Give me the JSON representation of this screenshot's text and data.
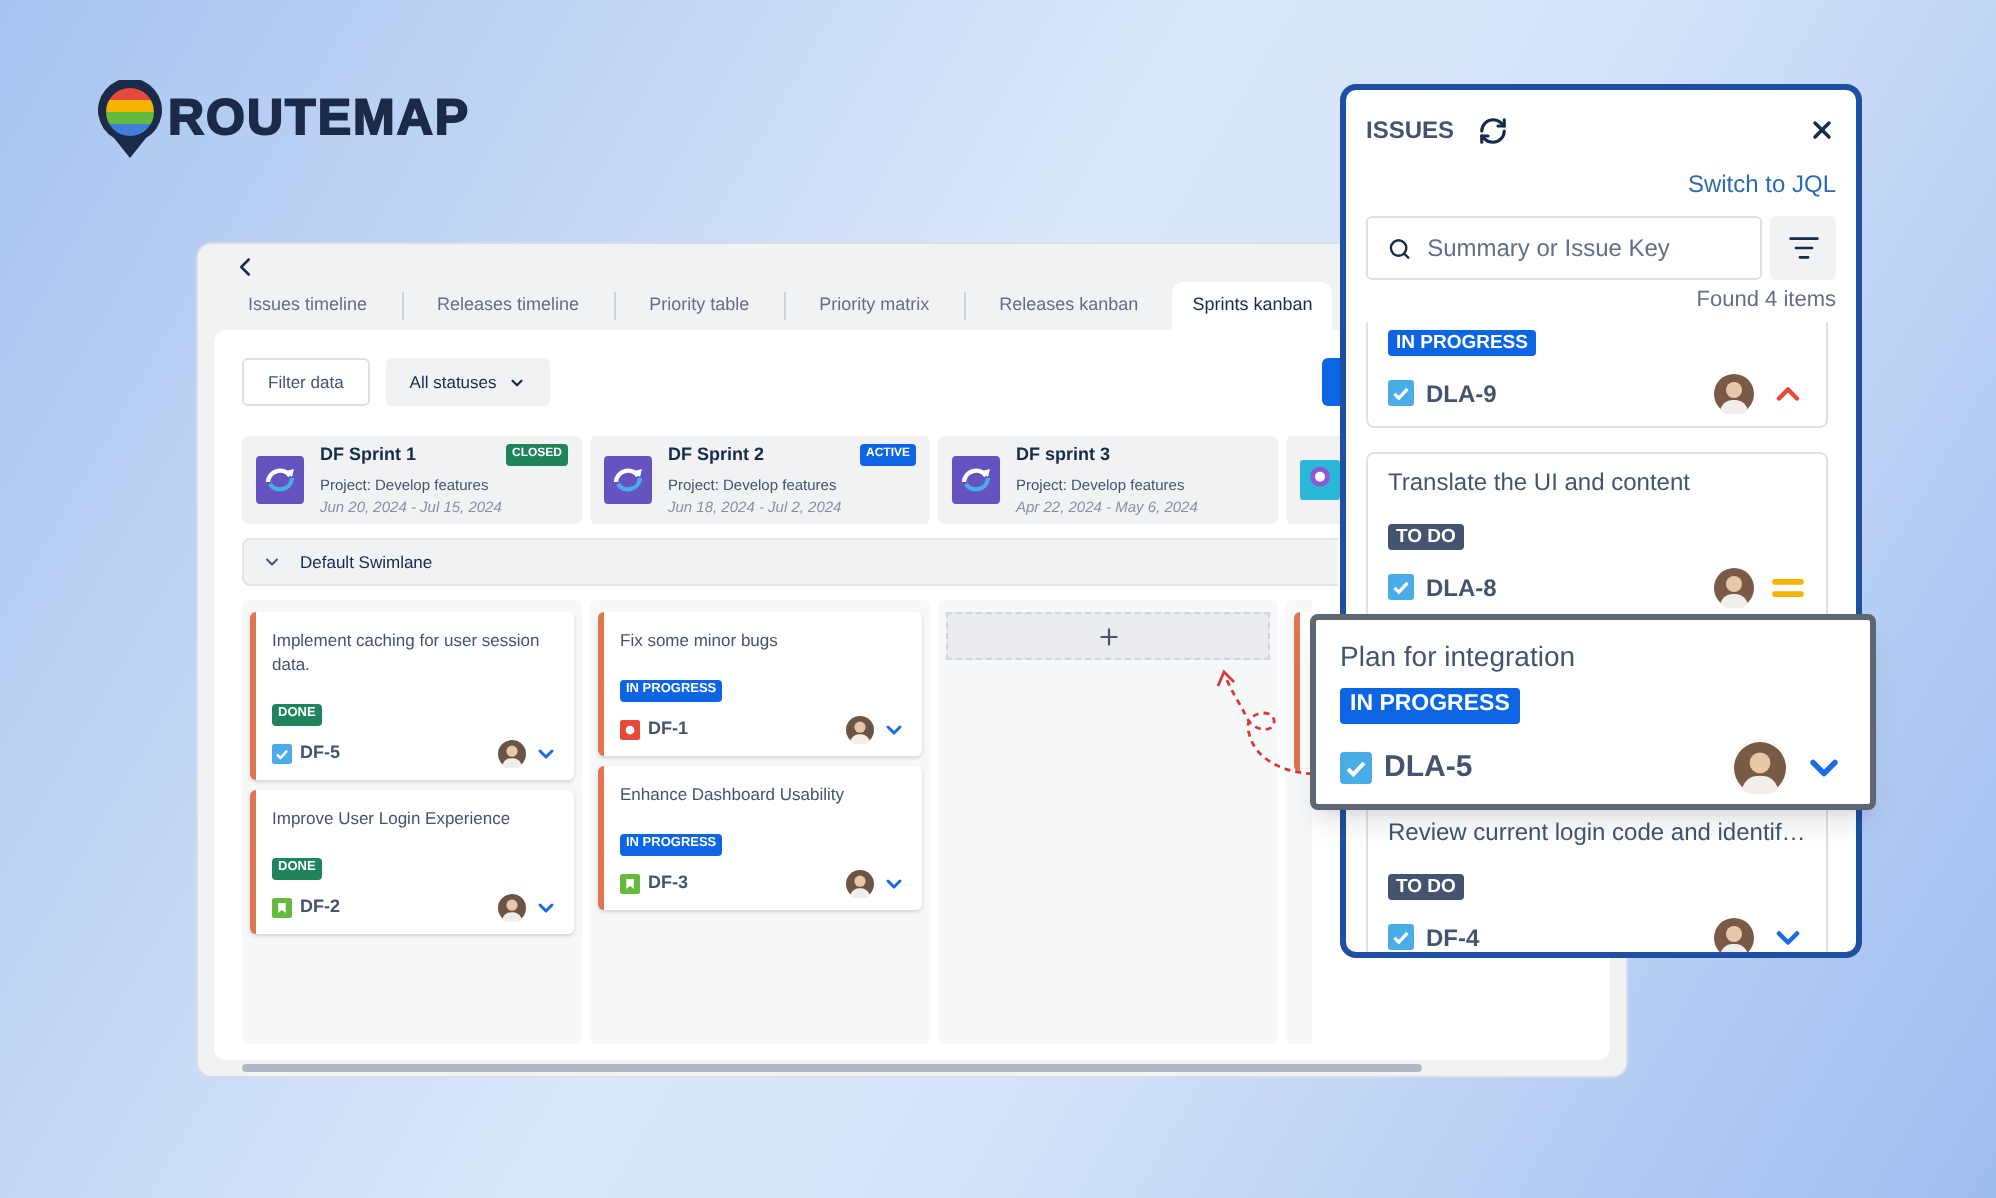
{
  "logo": {
    "text": "ROUTEMAP"
  },
  "main_window": {
    "tabs": [
      {
        "label": "Issues timeline",
        "selected": false
      },
      {
        "label": "Releases timeline",
        "selected": false
      },
      {
        "label": "Priority table",
        "selected": false
      },
      {
        "label": "Priority matrix",
        "selected": false
      },
      {
        "label": "Releases kanban",
        "selected": false
      },
      {
        "label": "Sprints kanban",
        "selected": true
      }
    ],
    "filter_button": "Filter data",
    "status_dropdown": "All statuses",
    "sprints": [
      {
        "name": "DF Sprint 1",
        "badge": {
          "label": "CLOSED",
          "kind": "closed"
        },
        "project": "Project: Develop features",
        "dates": "Jun 20, 2024 - Jul 15, 2024"
      },
      {
        "name": "DF Sprint 2",
        "badge": {
          "label": "ACTIVE",
          "kind": "active"
        },
        "project": "Project: Develop features",
        "dates": "Jun 18, 2024 - Jul 2, 2024"
      },
      {
        "name": "DF sprint 3",
        "project": "Project: Develop features",
        "dates": "Apr 22, 2024 - May 6, 2024"
      }
    ],
    "swimlane": {
      "label": "Default Swimlane",
      "expanded": true
    },
    "columns": [
      {
        "cards": [
          {
            "title": "Implement caching for user session data.",
            "status": {
              "label": "DONE",
              "kind": "done"
            },
            "key": "DF-5",
            "type_icon": {
              "kind": "task"
            },
            "priority_icon": {
              "kind": "low"
            }
          },
          {
            "title": "Improve User Login Experience",
            "status": {
              "label": "DONE",
              "kind": "done"
            },
            "key": "DF-2",
            "type_icon": {
              "kind": "story"
            },
            "priority_icon": {
              "kind": "low"
            }
          }
        ]
      },
      {
        "cards": [
          {
            "title": "Fix some minor bugs",
            "status": {
              "label": "IN PROGRESS",
              "kind": "in_progress"
            },
            "key": "DF-1",
            "type_icon": {
              "kind": "bug"
            },
            "priority_icon": {
              "kind": "low"
            }
          },
          {
            "title": "Enhance Dashboard Usability",
            "status": {
              "label": "IN PROGRESS",
              "kind": "in_progress"
            },
            "key": "DF-3",
            "type_icon": {
              "kind": "story"
            },
            "priority_icon": {
              "kind": "low"
            }
          }
        ]
      }
    ]
  },
  "issues_panel": {
    "title": "ISSUES",
    "switch_link": "Switch to JQL",
    "search": {
      "placeholder": "Summary or Issue Key"
    },
    "found": "Found 4 items",
    "issues": [
      {
        "status": {
          "label": "IN PROGRESS",
          "kind": "in_progress"
        },
        "key": "DLA-9",
        "type_icon": {
          "kind": "task"
        },
        "priority_icon": {
          "kind": "high"
        }
      },
      {
        "title": "Translate the UI and content",
        "status": {
          "label": "TO DO",
          "kind": "todo"
        },
        "key": "DLA-8",
        "type_icon": {
          "kind": "task"
        },
        "priority_icon": {
          "kind": "medium"
        }
      },
      {
        "title": "Review current login code and identif…",
        "status": {
          "label": "TO DO",
          "kind": "todo"
        },
        "key": "DF-4",
        "type_icon": {
          "kind": "task"
        },
        "priority_icon": {
          "kind": "low"
        }
      }
    ]
  },
  "dragged_card": {
    "title": "Plan for integration",
    "status": {
      "label": "IN PROGRESS",
      "kind": "in_progress"
    },
    "key": "DLA-5",
    "type_icon": {
      "kind": "task"
    },
    "priority_icon": {
      "kind": "low"
    }
  }
}
